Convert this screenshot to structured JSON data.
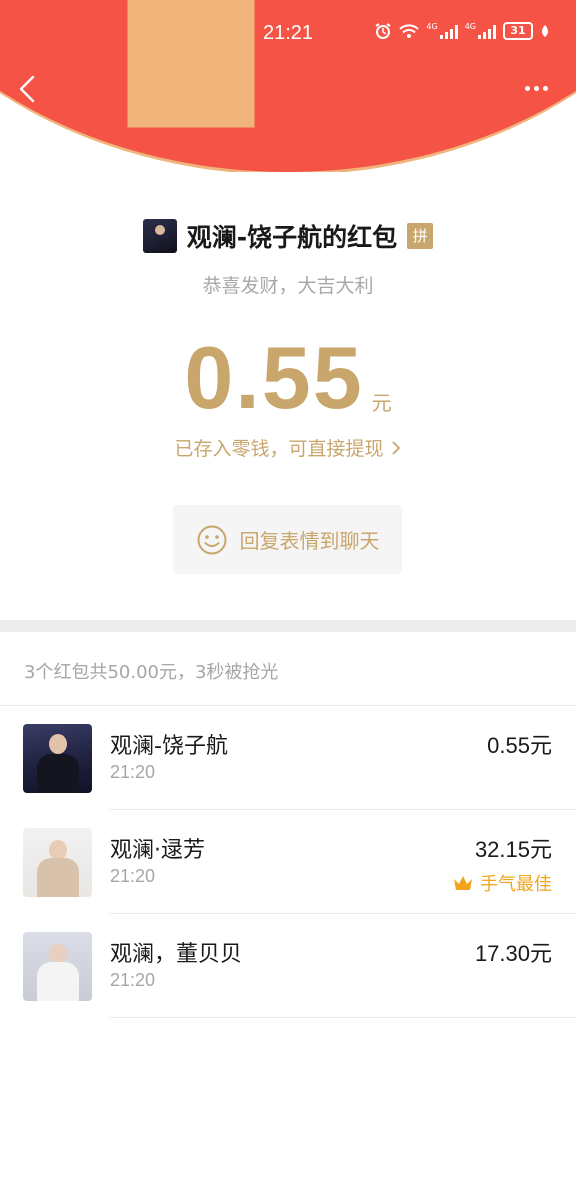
{
  "status_bar": {
    "time": "21:21",
    "battery": "31",
    "signal_1": "4G",
    "signal_2": "4G"
  },
  "header": {
    "back_icon": "chevron-left-icon",
    "more_icon": "more-dots-icon"
  },
  "red_packet": {
    "title": "观澜-饶子航的红包",
    "pin_badge": "拼",
    "greeting": "恭喜发财，大吉大利",
    "amount": "0.55",
    "unit": "元",
    "deposit_text": "已存入零钱，可直接提现",
    "reply_label": "回复表情到聊天"
  },
  "summary": "3个红包共50.00元，3秒被抢光",
  "recipients": [
    {
      "name": "观澜-饶子航",
      "time": "21:20",
      "amount": "0.55元",
      "badge": ""
    },
    {
      "name": "观澜·逯芳",
      "time": "21:20",
      "amount": "32.15元",
      "badge": "手气最佳"
    },
    {
      "name": "观澜，董贝贝",
      "time": "21:20",
      "amount": "17.30元",
      "badge": ""
    }
  ],
  "colors": {
    "header_red": "#f45345",
    "gold": "#c9a66b",
    "best_orange": "#f2a51c"
  }
}
